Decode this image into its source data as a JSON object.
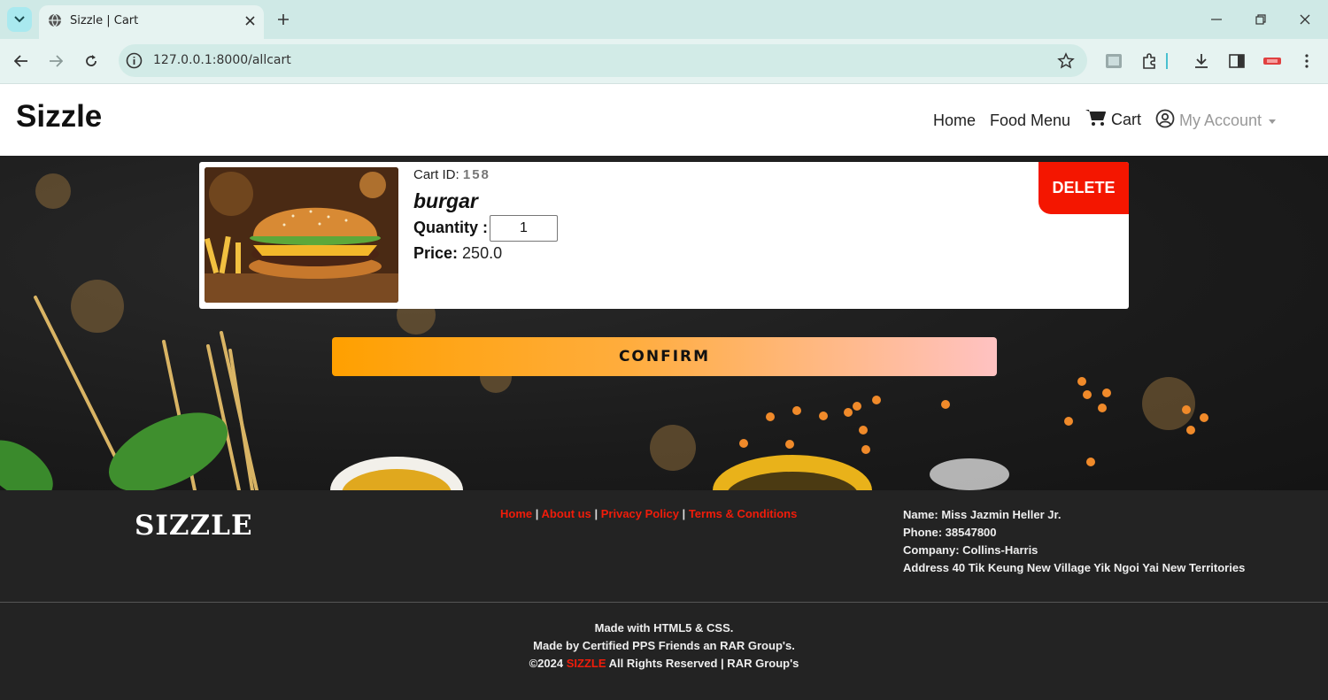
{
  "browser": {
    "tab_title": "Sizzle | Cart",
    "url": "127.0.0.1:8000/allcart"
  },
  "nav": {
    "brand": "Sizzle",
    "home": "Home",
    "food_menu": "Food Menu",
    "cart": "Cart",
    "account": "My Account"
  },
  "cart": {
    "id_label": "Cart ID:",
    "id_value": "158",
    "item_name": "burgar",
    "quantity_label": "Quantity :",
    "quantity_value": "1",
    "price_label": "Price:",
    "price_value": "250.0",
    "delete_label": "DELETE"
  },
  "confirm_label": "CONFIRM",
  "footer": {
    "logo": "SIZZLE",
    "links": [
      "Home",
      "About us",
      "Privacy Policy",
      "Terms & Conditions"
    ],
    "separator": "|",
    "contact": {
      "name": "Name: Miss Jazmin Heller Jr.",
      "phone": "Phone: 38547800",
      "company": "Company: Collins-Harris",
      "address": "Address 40 Tik Keung New Village Yik Ngoi Yai New Territories"
    },
    "made_with": "Made with HTML5 & CSS.",
    "made_by_prefix": "Made by Certified ",
    "made_by_group": "PPS Friends",
    "made_by_suffix": " an RAR Group's.",
    "copyright_prefix": "©2024 ",
    "copyright_brand": "SIZZLE",
    "copyright_suffix": " All Rights Reserved | RAR Group's"
  }
}
